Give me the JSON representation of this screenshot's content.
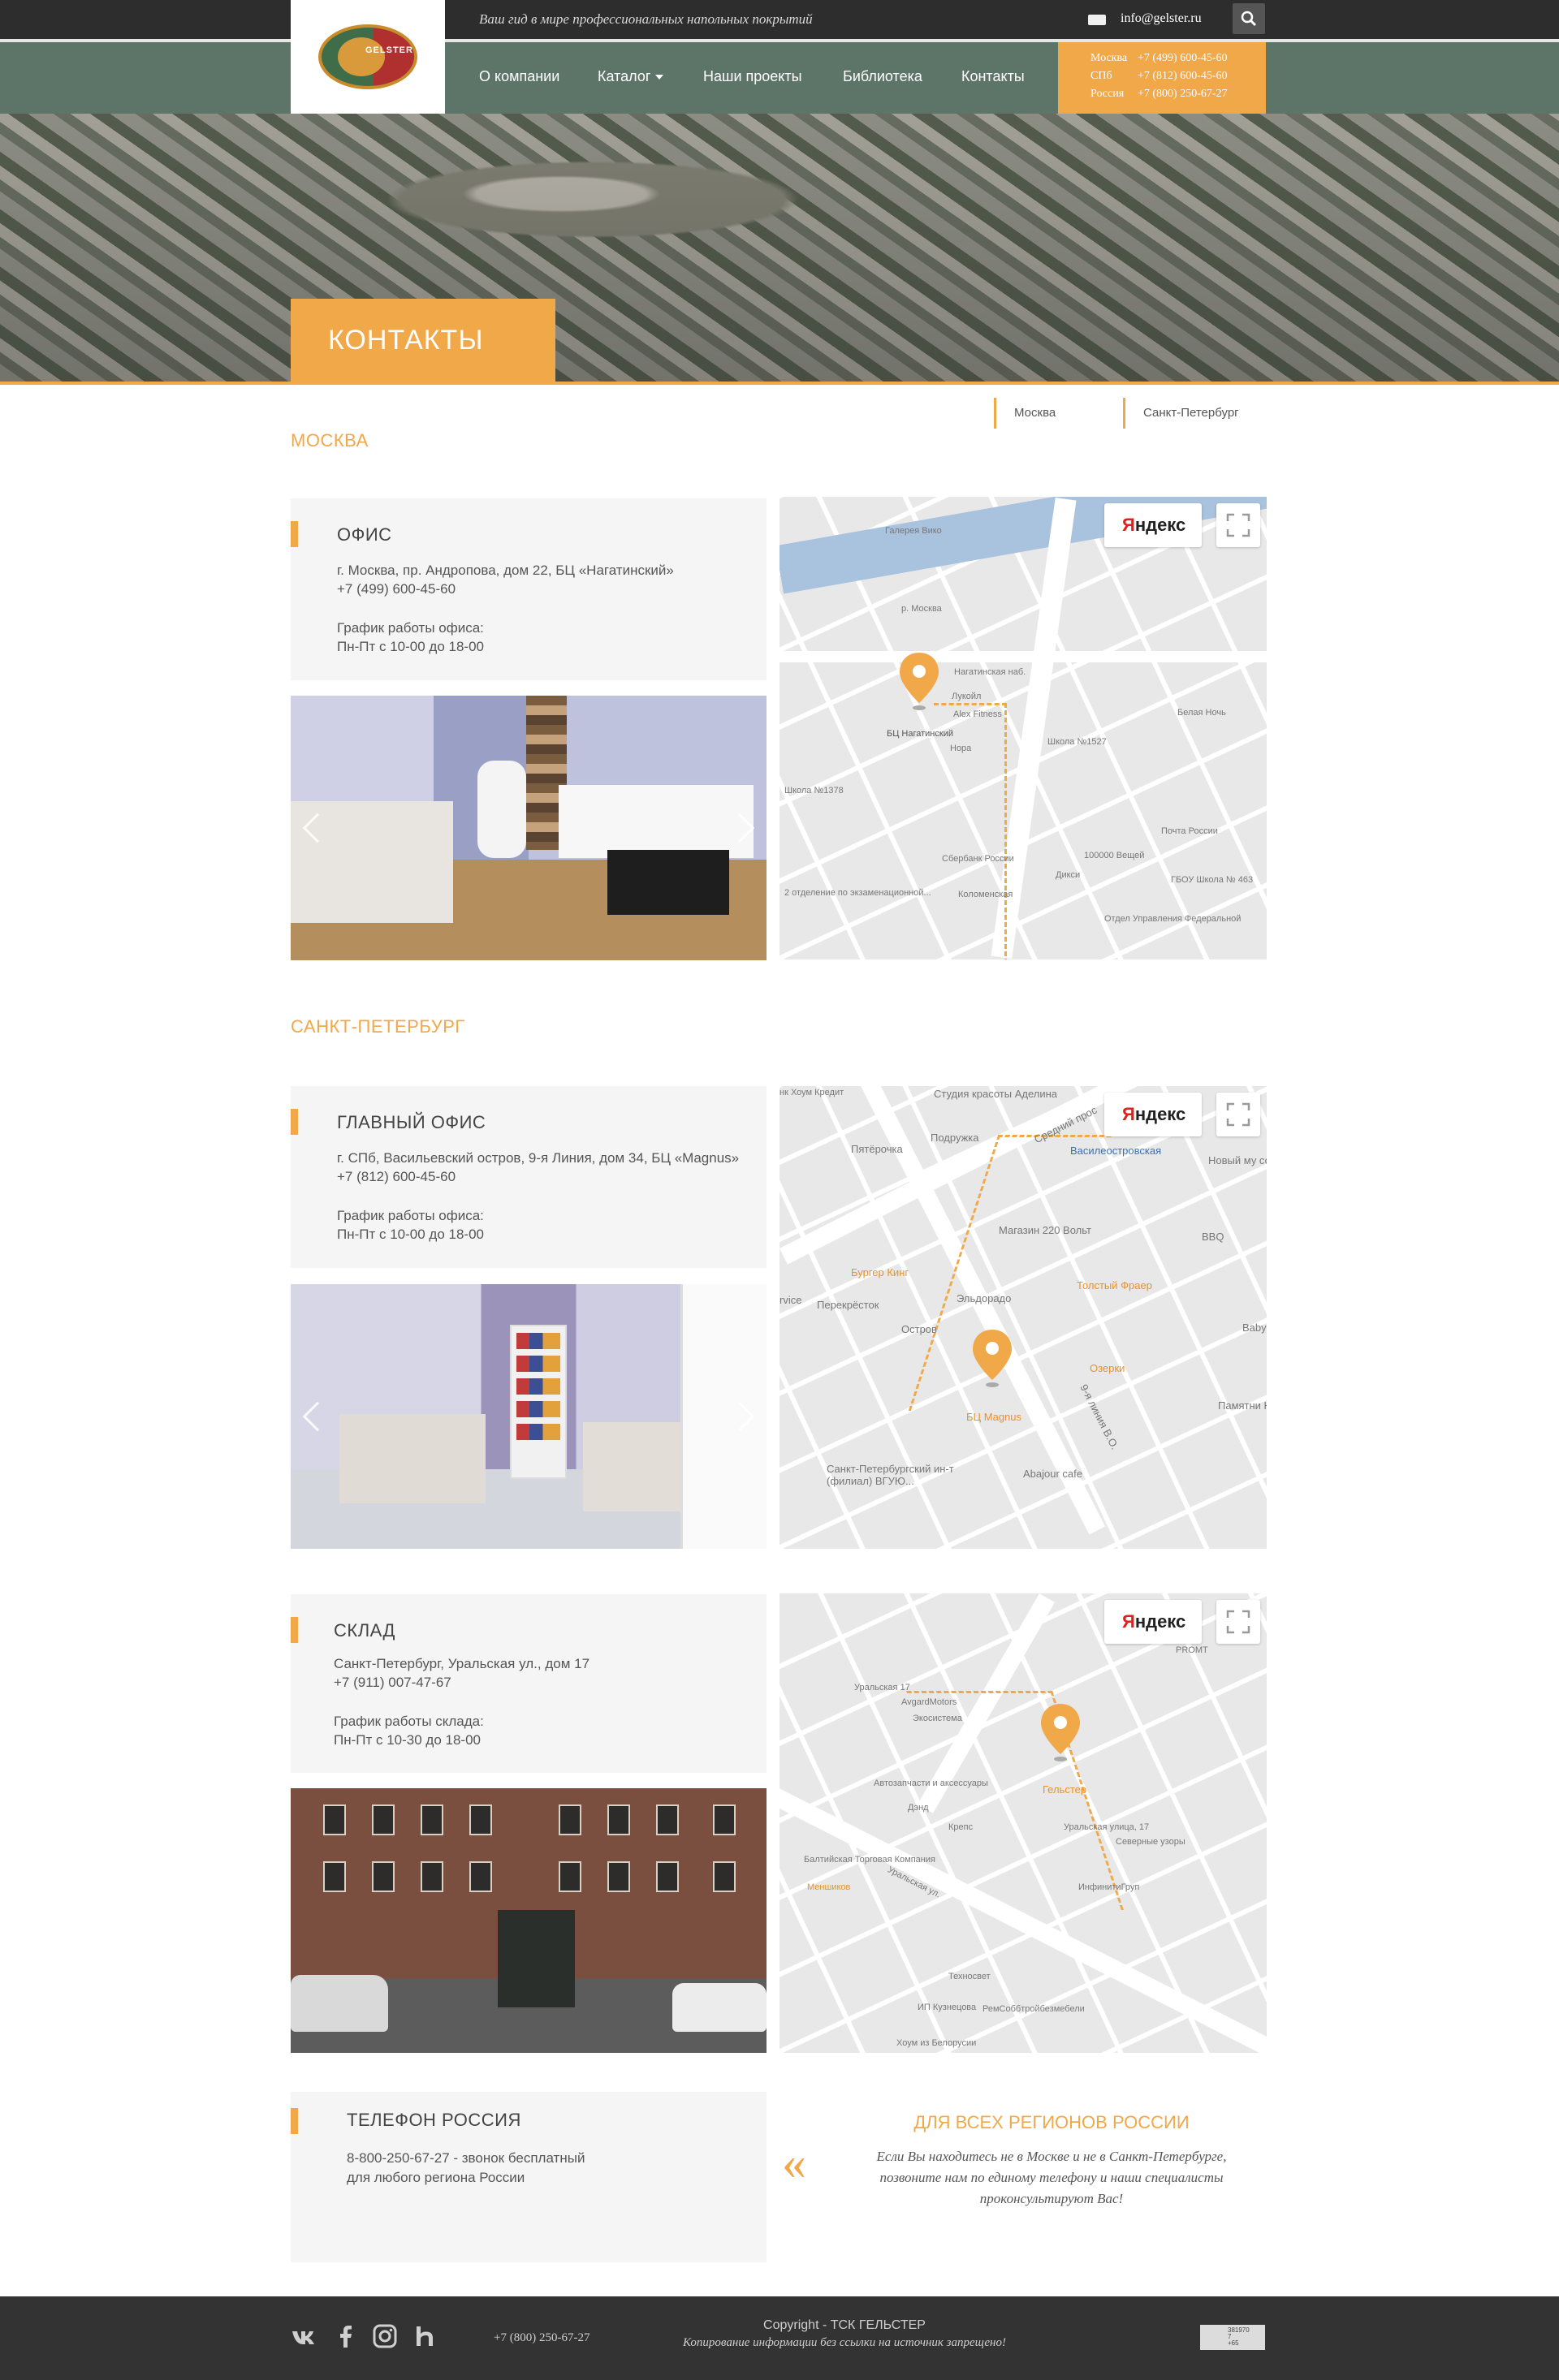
{
  "header": {
    "tagline": "Ваш гид в мире профессиональных напольных покрытий",
    "email": "info@gelster.ru",
    "logo_text": "GELSTER",
    "nav": [
      {
        "label": "О компании"
      },
      {
        "label": "Каталог"
      },
      {
        "label": "Наши проекты"
      },
      {
        "label": "Библиотека"
      },
      {
        "label": "Контакты"
      }
    ],
    "phones": [
      {
        "city": "Москва",
        "number": "+7 (499) 600-45-60"
      },
      {
        "city": "СПб",
        "number": "+7 (812) 600-45-60"
      },
      {
        "city": "Россия",
        "number": "+7 (800) 250-67-27"
      }
    ]
  },
  "hero": {
    "title": "КОНТАКТЫ"
  },
  "anchors": [
    "Москва",
    "Санкт-Петербург"
  ],
  "moscow": {
    "section_title": "МОСКВА",
    "office": {
      "heading": "ОФИС",
      "address": "г. Москва, пр. Андропова, дом 22, БЦ «Нагатинский»",
      "phone": "+7 (499) 600-45-60",
      "hours_label": "График работы офиса:",
      "hours": "Пн-Пт с 10-00 до 18-00"
    },
    "map": {
      "yandex": "Яндекс",
      "pin_label": "БЦ Нагатинский",
      "labels": [
        "Галерея Вико",
        "р. Москва",
        "Alex Fitness",
        "Нагатинская наб.",
        "Школа №1378",
        "Сбербанк России",
        "Коломенская",
        "Дикси",
        "Школа №1527",
        "Почта России",
        "ГБОУ Школа № 463",
        "Отдел Управления Федеральной",
        "Белая Ночь",
        "Нора",
        "Лукойл",
        "100000 Вещей",
        "2 отделение по экзаменационной..."
      ]
    }
  },
  "spb": {
    "section_title": "САНКТ-ПЕТЕРБУРГ",
    "office": {
      "heading": "ГЛАВНЫЙ ОФИС",
      "address": "г. СПб, Васильевский остров, 9-я Линия, дом 34, БЦ «Magnus»",
      "phone": "+7 (812) 600-45-60",
      "hours_label": "График работы офиса:",
      "hours": "Пн-Пт с 10-00 до 18-00"
    },
    "office_map": {
      "yandex": "Яндекс",
      "pin_label": "БЦ Magnus",
      "labels": [
        "нк Хоум Кредит",
        "Студия красоты Аделина",
        "Пятёрочка",
        "Подружка",
        "Средний прос",
        "Василеостровская",
        "Новый му современ",
        "Магазин 220 Вольт",
        "BBQ",
        "Бургер Кинг",
        "Толстый Фраер",
        "Перекрёсток",
        "Эльдорадо",
        "Остров",
        "Озерки",
        "Памятни Никс",
        "Abajour cafe",
        "Санкт-Петербургский ин-т (филиал) ВГУЮ...",
        "9-я линия В.О.",
        "rvice",
        "Baby"
      ]
    },
    "warehouse": {
      "heading": "СКЛАД",
      "address": "Санкт-Петербург,  Уральская ул., дом 17",
      "phone": "+7 (911) 007-47-67",
      "hours_label": "График работы склада:",
      "hours": "Пн-Пт с 10-30 до 18-00"
    },
    "warehouse_map": {
      "yandex": "Яндекс",
      "pin_label": "Гельстер",
      "labels": [
        "Уральская 17",
        "AvgardMotors",
        "Экосистема",
        "Автозапчасти и аксессуары",
        "Дэнд",
        "Крепс",
        "Балтийская Торговая Компания",
        "Меншиков",
        "Уральская ул.",
        "Уральская улица, 17",
        "Северные узоры",
        "ИнфинитиГруп",
        "Техносвет",
        "ИП Кузнецова",
        "РемСоббтройбезмебели",
        "Хоум из Белорусии",
        "PROMT"
      ]
    }
  },
  "russia": {
    "heading": "ТЕЛЕФОН РОССИЯ",
    "line1": "8-800-250-67-27 - звонок бесплатный",
    "line2": "для любого региона России",
    "regions_title": "ДЛЯ ВСЕХ РЕГИОНОВ РОССИИ",
    "regions_text": "Если Вы находитесь не в Москве и не в Санкт-Петербурге, позвоните нам по единому телефону и наши специалисты проконсультируют Вас!",
    "quote_glyph": "«"
  },
  "footer": {
    "phone": "+7 (800) 250-67-27",
    "copyright": "Copyright - ТСК ГЕЛЬСТЕР",
    "note": "Копирование информации без ссылки на источник запрещено!",
    "counter": [
      "381970",
      "7",
      "+65"
    ],
    "social": [
      "vk-icon",
      "facebook-icon",
      "instagram-icon",
      "hh-icon"
    ]
  },
  "colors": {
    "accent": "#f0a848",
    "nav": "#5d7569",
    "topbar": "#2d2d2d",
    "footer": "#333333"
  }
}
